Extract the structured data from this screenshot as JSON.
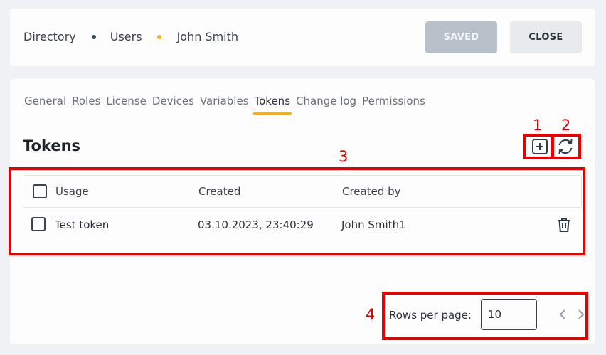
{
  "breadcrumb": {
    "items": [
      "Directory",
      "Users",
      "John Smith"
    ],
    "dot_colors": [
      "#2f4a63",
      "#f2b01e"
    ]
  },
  "header": {
    "saved_label": "SAVED",
    "close_label": "CLOSE"
  },
  "tabs": [
    "General",
    "Roles",
    "License",
    "Devices",
    "Variables",
    "Tokens",
    "Change log",
    "Permissions"
  ],
  "active_tab": "Tokens",
  "section": {
    "title": "Tokens"
  },
  "toolbar": {
    "add_icon": "plus-square-icon",
    "refresh_icon": "refresh-icon"
  },
  "table": {
    "columns": [
      "Usage",
      "Created",
      "Created by"
    ],
    "rows": [
      {
        "usage": "Test token",
        "created": "03.10.2023, 23:40:29",
        "created_by": "John Smith1",
        "action_icon": "trash-icon"
      }
    ]
  },
  "pagination": {
    "rows_per_page_label": "Rows per page:",
    "rows_per_page_value": "10"
  },
  "annotations": [
    "1",
    "2",
    "3",
    "4"
  ],
  "colors": {
    "accent": "#f2b01e",
    "annotation": "#e60000",
    "saved_button": "#b8c1c9"
  }
}
